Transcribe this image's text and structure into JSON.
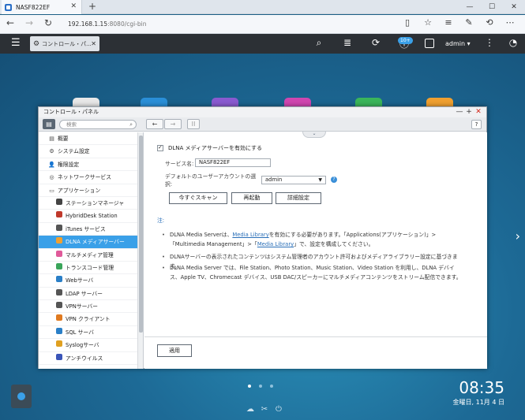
{
  "browser": {
    "tab_title": "NASF822EF",
    "new_tab": "+",
    "url_host": "192.168.1.15",
    "url_path": ":8080/cgi-bin",
    "win_min": "—",
    "win_max": "☐",
    "win_close": "✕"
  },
  "qts": {
    "app_tab": "コントロール・パ...",
    "badge": "10+",
    "user": "admin ▾"
  },
  "window": {
    "title": "コントロール・パネル",
    "search_placeholder": "検索"
  },
  "sidebar": {
    "items": [
      {
        "label": "概要",
        "icon": "overview-icon",
        "glyph": "▤"
      },
      {
        "label": "システム設定",
        "icon": "gear-icon",
        "glyph": "⚙"
      },
      {
        "label": "権限設定",
        "icon": "user-icon",
        "glyph": "👤"
      },
      {
        "label": "ネットワークサービス",
        "icon": "globe-icon",
        "glyph": "◎"
      },
      {
        "label": "アプリケーション",
        "icon": "apps-icon",
        "glyph": "▭"
      }
    ],
    "subitems": [
      {
        "label": "ステーションマネージャ",
        "icon": "station-manager-icon",
        "color": "#444"
      },
      {
        "label": "HybridDesk Station",
        "icon": "hybriddesk-icon",
        "color": "#c0392b"
      },
      {
        "label": "iTunes サービス",
        "icon": "itunes-icon",
        "color": "#555"
      },
      {
        "label": "DLNA メディアサーバー",
        "icon": "dlna-icon",
        "color": "#f0a030"
      },
      {
        "label": "マルチメディア管理",
        "icon": "multimedia-icon",
        "color": "#e05a9a"
      },
      {
        "label": "トランスコード管理",
        "icon": "transcode-icon",
        "color": "#3aa55a"
      },
      {
        "label": "Webサーバ",
        "icon": "web-server-icon",
        "color": "#2a7fc7"
      },
      {
        "label": "LDAP サーバー",
        "icon": "ldap-icon",
        "color": "#555"
      },
      {
        "label": "VPNサーバー",
        "icon": "vpn-server-icon",
        "color": "#555"
      },
      {
        "label": "VPN クライアント",
        "icon": "vpn-client-icon",
        "color": "#e07a20"
      },
      {
        "label": "SQL サーバ",
        "icon": "sql-icon",
        "color": "#2a7fc7"
      },
      {
        "label": "Syslogサーバ",
        "icon": "syslog-icon",
        "color": "#e0a020"
      },
      {
        "label": "アンチウイルス",
        "icon": "antivirus-icon",
        "color": "#3a55b8"
      }
    ],
    "selected": "DLNA メディアサーバー"
  },
  "dlna": {
    "enable_label": "DLNA メディアサーバーを有効にする",
    "service_name_label": "サービス名:",
    "service_name_value": "NASF822EF",
    "default_user_label": "デフォルトのユーザーアカウントの選択:",
    "default_user_value": "admin",
    "buttons": {
      "scan": "今すぐスキャン",
      "restart": "再起動",
      "advanced": "詳細設定"
    },
    "note_title": "注:",
    "notes": {
      "n1_a": "DLNA Media Serverは、",
      "n1_link1": "Media Library",
      "n1_b": "を有効にする必要があります。「Applications(アプリケーション)」>「Multimedia Management」>「",
      "n1_link2": "Media Library",
      "n1_c": "」で、設定を構成してください。",
      "n2": "DLNAサーバーの表示されたコンテンツはシステム管理者のアカウント許可およびメディアライブラリー設定に基づきます。",
      "n3": "DLNA Media Server では、File Station、Photo Station、Music Station、Video Station を利用し、DLNA デバイス、Apple TV、Chromecast デバイス、USB DAC/スピーカーにマルチメディアコンテンツをストリーム配信できます。"
    },
    "apply": "適用"
  },
  "desktop": {
    "time": "08:35",
    "date": "金曜日, 11月 4 日"
  }
}
